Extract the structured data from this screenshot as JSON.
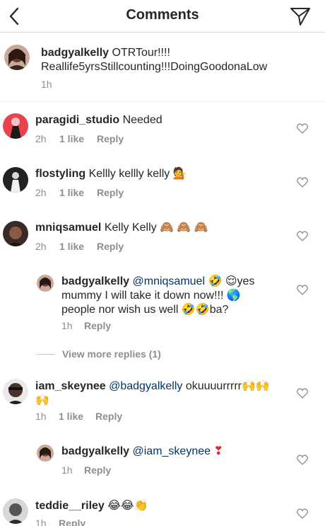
{
  "header": {
    "title": "Comments"
  },
  "caption": {
    "username": "badgyalkelly",
    "text": "OTRTour!!!! Reallife5yrsStillcounting!!!DoingGoodonaLow",
    "time": "1h"
  },
  "comments": [
    {
      "username": "paragidi_studio",
      "text": "Needed",
      "time": "2h",
      "likes": "1 like",
      "reply": "Reply"
    },
    {
      "username": "flostyling",
      "text": "Kellly kellly kelly 💁",
      "time": "2h",
      "likes": "1 like",
      "reply": "Reply"
    },
    {
      "username": "mniqsamuel",
      "text": "Kelly Kelly 🙈 🙈 🙈",
      "time": "2h",
      "likes": "1 like",
      "reply": "Reply"
    },
    {
      "username": "badgyalkelly",
      "mention": "@mniqsamuel",
      "text_line1": " 🤣 😌yes",
      "text_line2": "mummy I will take it down now!!! 🌎",
      "text_line3": "people nor wish us well 🤣🤣ba?",
      "time": "1h",
      "reply": "Reply"
    },
    {
      "username": "iam_skeynee",
      "mention": "@badgyalkelly",
      "text": " okuuuurrrrr🙌🙌",
      "text_line2": "🙌",
      "time": "1h",
      "likes": "1 like",
      "reply": "Reply"
    },
    {
      "username": "badgyalkelly",
      "mention": "@iam_skeynee",
      "text": " ❣",
      "time": "1h",
      "reply": "Reply"
    },
    {
      "username": "teddie__riley",
      "text": "😂😂👏",
      "time": "1h",
      "reply": "Reply"
    }
  ],
  "view_more": "View more replies (1)",
  "colors": {
    "text": "#262626",
    "secondary": "#8e8e8e",
    "mention": "#003569",
    "divider": "#dbdbdb"
  },
  "icons": [
    "back-chevron-icon",
    "paper-plane-icon",
    "heart-outline-icon"
  ]
}
